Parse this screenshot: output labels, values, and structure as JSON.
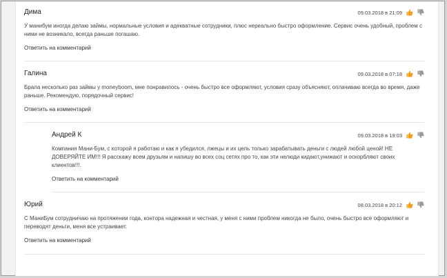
{
  "comments": [
    {
      "author": "Дима",
      "date": "09.03.2018 в 21:09",
      "text": "У манибум иногда делаю займы, нормальные условия и адекватные сотрудники, плюс нереально быстро оформление. Сервис очень удобный, проблем с ними не возникало, всегда раньше погашаю.",
      "reply_label": "Ответить на комментарий"
    },
    {
      "author": "Галина",
      "date": "09.03.2018 в 07:18",
      "text": "Брала несколько раз займы у moneyboom, мне понравилось - очень быстро все оформляют, условия сразу объясняют, оплачиваю всегда во время, даже раньше. Рекомендую, порядочный сервис!",
      "reply_label": "Ответить на комментарий"
    },
    {
      "author": "Андрей К",
      "date": "09.03.2018 в 19:03",
      "text": "Компания Мани-Бум, с которой я работаю и как я убедился, лжецы и их цель только зарабатывать деньги с людей любой ценой! НЕ ДОВЕРЯЙТЕ ИМ!!! Я расскажу всем друзьям и напишу во всех соц сетях про то, как эти нелюди кидают,унижают и оскорбляют своих клиентов!!!.",
      "reply_label": "Ответить на комментарий"
    },
    {
      "author": "Юрий",
      "date": "08.03.2018 в 20:12",
      "text": "С МаниБум сотрудничаю на протяжении года, контора надежная и честная, у меня с ними проблем никогда не было, очень быстро все оформляют и переводят деньги, меня все устраивает.",
      "reply_label": "Ответить на комментарий"
    }
  ],
  "icons": {
    "like": "thumbs-up-icon",
    "dislike": "thumbs-down-icon"
  },
  "colors": {
    "like": "#f0a020",
    "dislike": "#9a9a9a",
    "background": "#d4d4d4"
  }
}
